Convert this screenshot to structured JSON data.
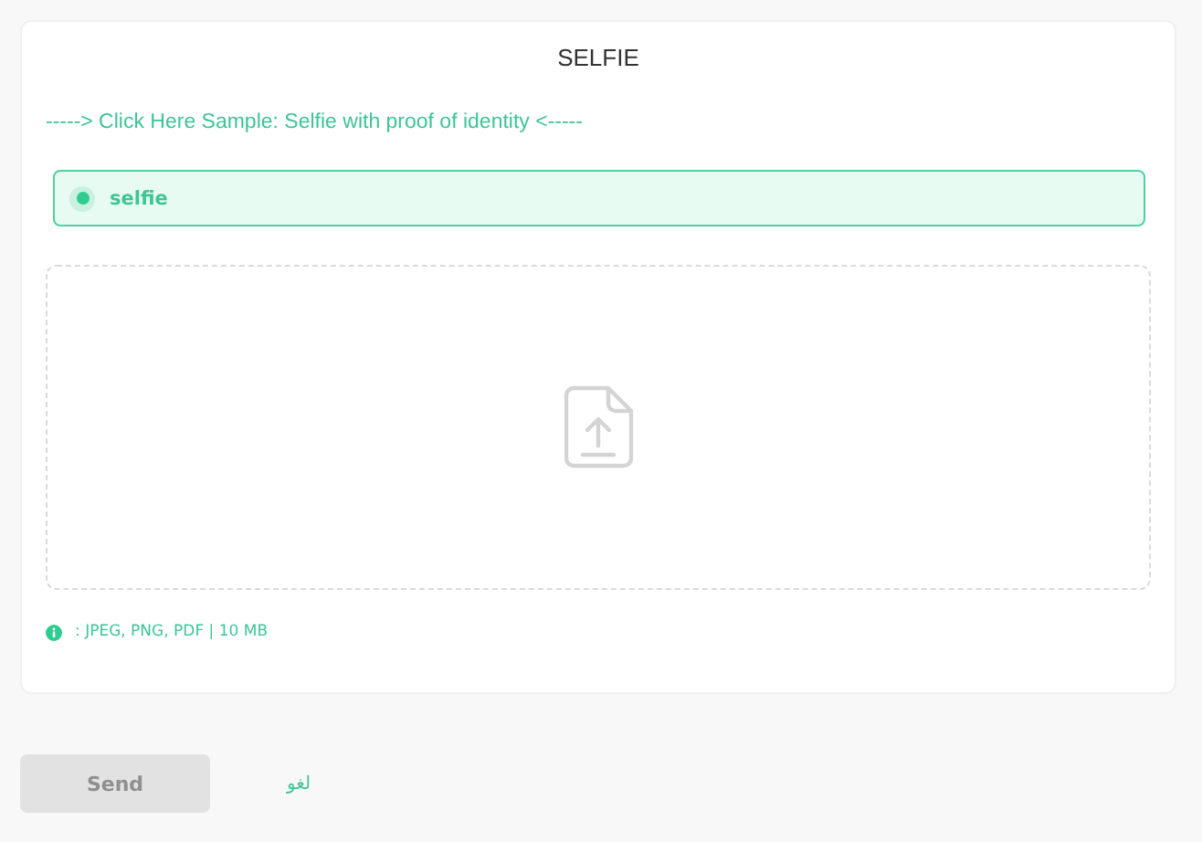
{
  "card": {
    "title": "SELFIE",
    "sample_link": "-----> Click Here Sample: Selfie with proof of identity <-----",
    "options": [
      {
        "label": "selfie",
        "selected": true
      }
    ],
    "upload_hint": ": JPEG, PNG, PDF | 10 MB"
  },
  "buttons": {
    "send": {
      "label": "Send",
      "disabled": true
    },
    "cancel": {
      "label": "لغو"
    }
  }
}
